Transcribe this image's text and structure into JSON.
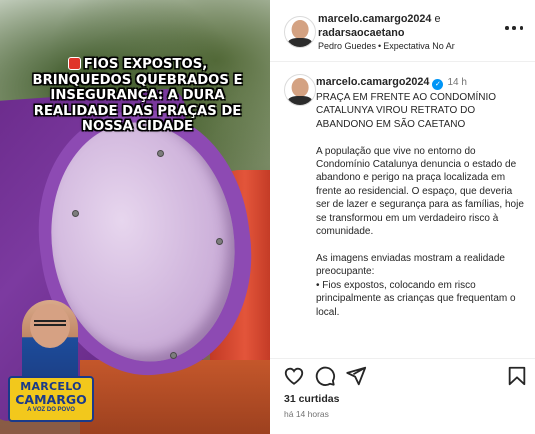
{
  "media": {
    "caption": "FIOS EXPOSTOS, BRINQUEDOS QUEBRADOS E INSEGURANÇA: A DURA REALIDADE DAS PRAÇAS DE NOSSA CIDADE",
    "badge": {
      "line1": "MARCELO",
      "line2": "CAMARGO",
      "line3": "A VOZ DO POVO"
    }
  },
  "header": {
    "user1": "marcelo.camargo2024",
    "conjunction": "e",
    "user2": "radarsaocaetano",
    "audio_artist": "Pedro Guedes",
    "audio_track": "Expectativa No Ar"
  },
  "caption_post": {
    "username": "marcelo.camargo2024",
    "time": "14 h",
    "text": "PRAÇA EM FRENTE AO CONDOMÍNIO CATALUNYA VIROU RETRATO DO ABANDONO EM SÃO CAETANO\n\nA população que vive no entorno do Condomínio Catalunya denuncia o estado de abandono e perigo na praça localizada em frente ao residencial. O espaço, que deveria ser de lazer e segurança para as famílias, hoje se transformou em um verdadeiro risco à comunidade.\n\nAs imagens enviadas mostram a realidade preocupante:\n•      Fios expostos, colocando em risco principalmente as crianças que frequentam o local."
  },
  "stats": {
    "likes": "31 curtidas",
    "posted": "há 14 horas"
  },
  "icons": {
    "like": "heart-icon",
    "comment": "comment-icon",
    "share": "send-icon",
    "save": "bookmark-icon",
    "more": "more-icon",
    "verified": "verified-icon"
  },
  "colors": {
    "verified": "#0095f6",
    "badge_yellow": "#f2c81c",
    "badge_blue": "#1a3a8a"
  }
}
